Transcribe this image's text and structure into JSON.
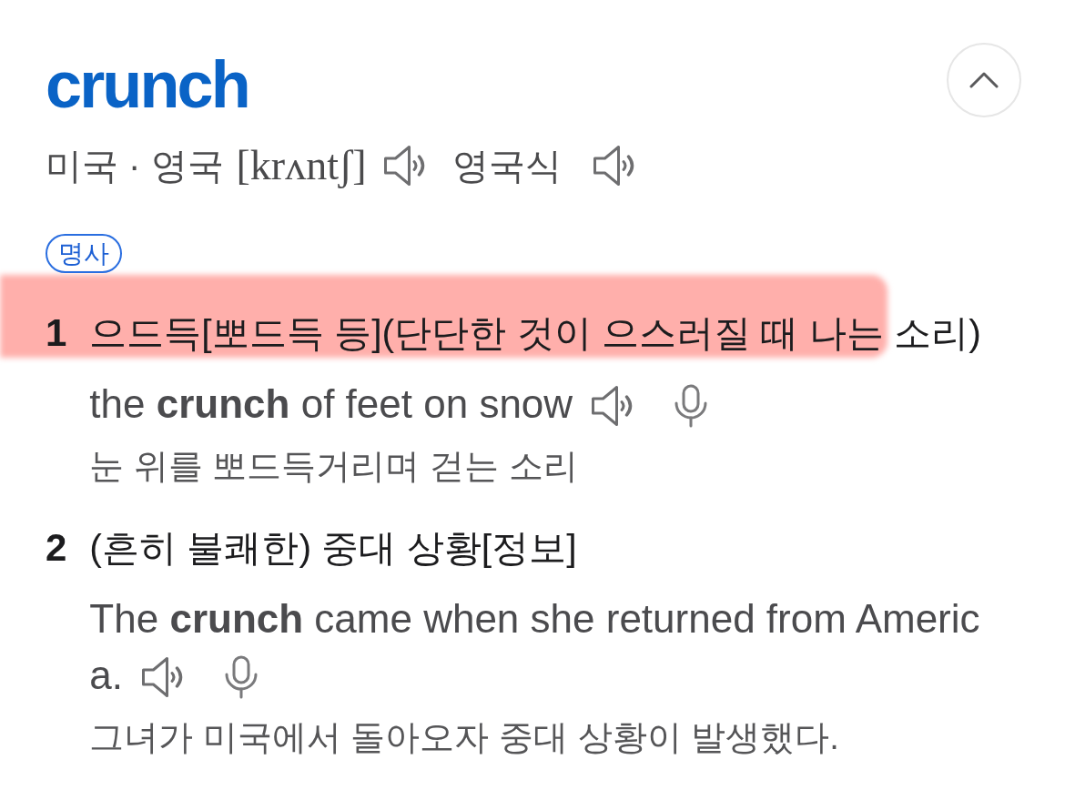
{
  "entry": {
    "headword": "crunch",
    "expanded": true,
    "pronunciations": [
      {
        "region": "미국 · 영국",
        "ipa": "[krʌntʃ]"
      },
      {
        "region": "영국식"
      }
    ],
    "part_of_speech": "명사",
    "senses": [
      {
        "number": "1",
        "definition": [
          {
            "text": "으드득[뽀드득 등](단단한 것이 으스러질 때 나는",
            "highlighted": true
          },
          {
            "text": "소리)",
            "highlighted": false
          }
        ],
        "examples": [
          {
            "sentence_lines": [
              "the **crunch** of feet on snow"
            ],
            "translation": "눈 위를 뽀드득거리며 걷는 소리"
          }
        ]
      },
      {
        "number": "2",
        "definition": [
          {
            "text": "(흔히 불쾌한) 중대 상황[정보]",
            "highlighted": false
          }
        ],
        "examples": [
          {
            "sentence_lines": [
              "The **crunch** came when she returned from Americ",
              "a."
            ],
            "translation": "그녀가 미국에서 돌아오자 중대 상황이 발생했다."
          }
        ]
      }
    ]
  }
}
